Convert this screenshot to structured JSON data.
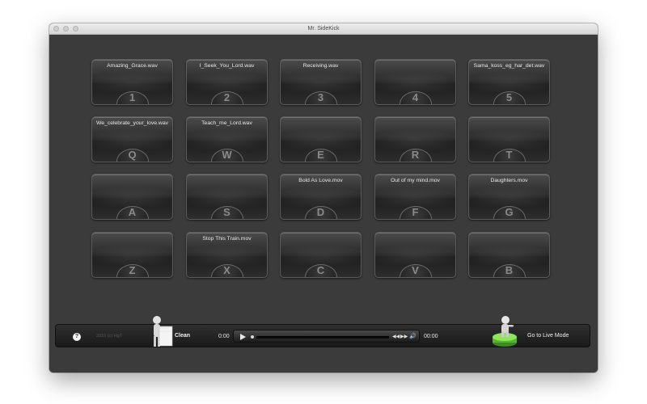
{
  "window": {
    "title": "Mr. SideKick"
  },
  "pads": [
    {
      "title": "Amazing_Grace.wav",
      "key": "1"
    },
    {
      "title": "I_Seek_You_Lord.wav",
      "key": "2"
    },
    {
      "title": "Receiving.wav",
      "key": "3"
    },
    {
      "title": "",
      "key": "4"
    },
    {
      "title": "Sama_koss_eg_har_det.wav",
      "key": "5"
    },
    {
      "title": "We_celebrate_your_love.wav",
      "key": "Q"
    },
    {
      "title": "Teach_me_Lord.wav",
      "key": "W"
    },
    {
      "title": "",
      "key": "E"
    },
    {
      "title": "",
      "key": "R"
    },
    {
      "title": "",
      "key": "T"
    },
    {
      "title": "",
      "key": "A"
    },
    {
      "title": "",
      "key": "S"
    },
    {
      "title": "Bold As Love.mov",
      "key": "D"
    },
    {
      "title": "Out of my mind.mov",
      "key": "F"
    },
    {
      "title": "Daughters.mov",
      "key": "G"
    },
    {
      "title": "",
      "key": "Z"
    },
    {
      "title": "Stop This Train.mov",
      "key": "X"
    },
    {
      "title": "",
      "key": "C"
    },
    {
      "title": "",
      "key": "V"
    },
    {
      "title": "",
      "key": "B"
    }
  ],
  "bottom": {
    "help": "?",
    "copyright": "2016 (c) HgT",
    "clean_label": "Clean",
    "time_start": "0:00",
    "time_end": "00:00",
    "live_label": "Go to Live Mode"
  },
  "controls": {
    "rewind": "◀◀",
    "forward": "▶▶",
    "volume": "🔊"
  },
  "colors": {
    "accent": "#6fd03a",
    "background": "#3b3b3b"
  }
}
